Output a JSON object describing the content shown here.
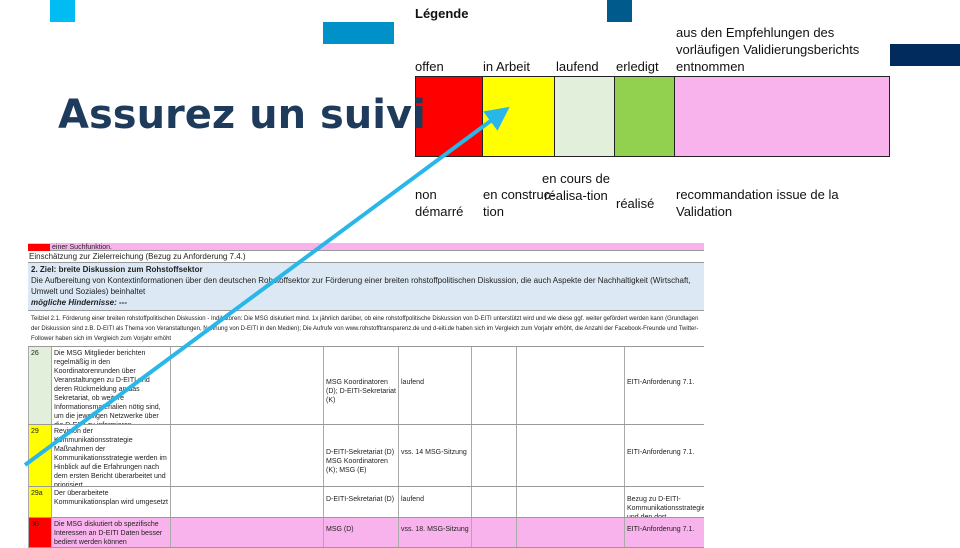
{
  "slide_title": "Assurez un suivi",
  "legend": {
    "heading": "Légende",
    "labels_de": [
      "offen",
      "in Arbeit",
      "laufend",
      "erledigt",
      "aus den Empfehlungen des vorläufigen Validierungsberichts entnommen"
    ],
    "labels_fr": [
      "non démarré",
      "en construc-tion",
      "en cours de réalisa-tion",
      "réalisé",
      "recommandation issue de la Validation"
    ],
    "colors": [
      "#ff0000",
      "#ffff00",
      "#e2efda",
      "#92d050",
      "#f9b3ec"
    ]
  },
  "table": {
    "row_top": "einer Suchfunktion.",
    "assessment": "Einschätzung zur Zielerreichung (Bezug zu Anforderung 7.4.)",
    "goal_title": "2. Ziel: breite Diskussion zum Rohstoffsektor",
    "goal_text": "Die Aufbereitung von Kontextinformationen über den deutschen Rohstoffsektor zur Förderung einer breiten rohstoffpolitischen Diskussion, die auch Aspekte der Nachhaltigkeit (Wirtschaft, Umwelt und Soziales) beinhaltet",
    "obstacles": "mögliche Hindernisse: ---",
    "subgoal": "Teilziel 2.1. Förderung einer breiten rohstoffpolitischen Diskussion - Indikatoren: Die MSG diskutiert mind. 1x jährlich darüber, ob eine rohstoffpolitische Diskussion von D-EITI unterstützt wird und wie diese ggf. weiter gefördert werden kann (Grundlagen der Diskussion sind z.B. D-EITI als Thema von Veranstaltungen, Nennung von D-EITI in den Medien); Die Aufrufe von www.rohstofftransparenz.de und d-eiti.de haben sich im Vergleich zum Vorjahr erhöht, die Anzahl der Facebook-Freunde und Twitter-Follower haben sich im Vergleich zum Vorjahr erhöht",
    "rows": [
      {
        "num": "26",
        "color": "#e2efda",
        "text": "Die MSG Mitglieder berichten regelmäßig in den Koordinatorenrunden über Veranstaltungen zu D-EITI und deren Rückmeldung an das Sekretariat, ob weitere Informationsmaterialien nötig sind, um die jeweiligen Netzwerke über die D-EITI zu informieren.",
        "resp": "MSG Koordinatoren (D); D-EITI-Sekretariat (K)",
        "status": "laufend",
        "ref": "EITI-Anforderung 7.1."
      },
      {
        "num": "29",
        "color": "#ffff00",
        "text": "Revision der Kommunikationsstrategie Maßnahmen der Kommunikationsstrategie werden im Hinblick auf die Erfahrungen nach dem ersten Bericht überarbeitet und priorisiert.",
        "resp": "D-EITI-Sekretariat (D) MSG Koordinatoren (K); MSG (E)",
        "status": "vss. 14 MSG-Sitzung",
        "ref": "EITI-Anforderung 7.1."
      },
      {
        "num": "29a",
        "color": "#ffff00",
        "text": "Der überarbeitete Kommunikationsplan wird umgesetzt",
        "resp": "D-EITI-Sekretariat (D)",
        "status": "laufend",
        "ref": "Bezug zu D-EITI-Kommunikationsstrategie und den dort vereinbarten Maßnahmen"
      },
      {
        "num": "30",
        "color": "#ff0000",
        "text": "Die MSG diskutiert ob spezifische Interessen an D-EITI Daten besser bedient werden können",
        "resp": "MSG (D)",
        "status": "vss. 18. MSG-Sitzung",
        "ref": "EITI-Anforderung 7.1."
      }
    ]
  },
  "accent_colors": {
    "arrow": "#29b6e8",
    "title": "#1f3b5c"
  }
}
